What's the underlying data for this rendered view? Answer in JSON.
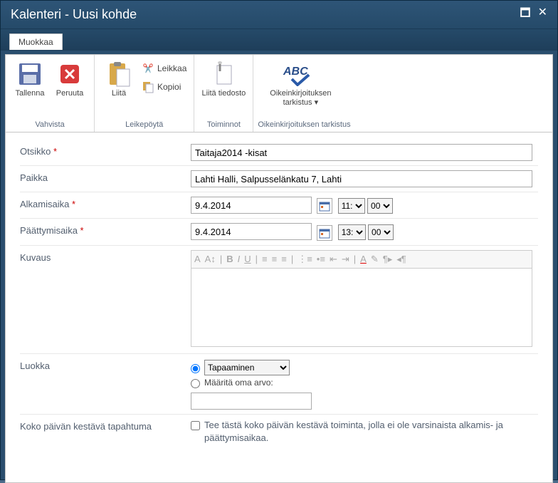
{
  "window": {
    "title": "Kalenteri - Uusi kohde"
  },
  "tab": {
    "edit": "Muokkaa"
  },
  "ribbon": {
    "save": "Tallenna",
    "cancel": "Peruuta",
    "group_confirm": "Vahvista",
    "paste": "Liitä",
    "cut": "Leikkaa",
    "copy": "Kopioi",
    "group_clipboard": "Leikepöytä",
    "attach": "Liitä tiedosto",
    "group_actions": "Toiminnot",
    "spell": "Oikeinkirjoituksen tarkistus",
    "group_spell": "Oikeinkirjoituksen tarkistus"
  },
  "form": {
    "labels": {
      "title": "Otsikko",
      "location": "Paikka",
      "start": "Alkamisaika",
      "end": "Päättymisaika",
      "description": "Kuvaus",
      "category": "Luokka",
      "allday": "Koko päivän kestävä tapahtuma"
    },
    "values": {
      "title": "Taitaja2014 -kisat",
      "location": "Lahti Halli, Salpusselänkatu 7, Lahti",
      "start_date": "9.4.2014",
      "start_hour": "11:",
      "start_min": "00",
      "end_date": "9.4.2014",
      "end_hour": "13:",
      "end_min": "00",
      "category_selected": "Tapaaminen",
      "category_custom_label": "Määritä oma arvo:",
      "allday_text": "Tee tästä koko päivän kestävä toiminta, jolla ei ole varsinaista alkamis- ja päättymisaikaa."
    }
  }
}
